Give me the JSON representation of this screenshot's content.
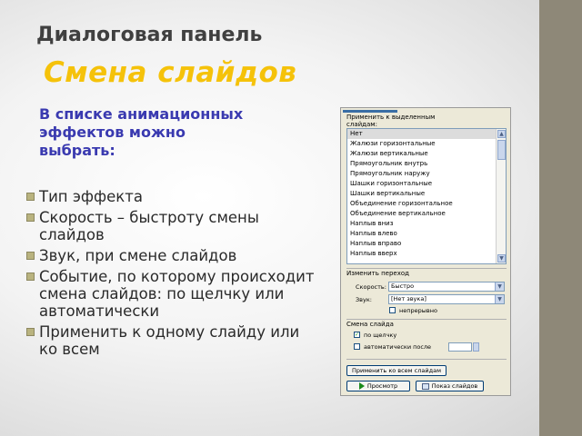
{
  "slide": {
    "title_line1": "Диалоговая панель",
    "title_line2": "Смена слайдов",
    "intro": "В списке анимационных эффектов можно выбрать:",
    "bullets": [
      "Тип эффекта",
      "Скорость – быстроту смены слайдов",
      "Звук, при смене слайдов",
      "Событие, по которому происходит смена слайдов: по щелчку или автоматически",
      "Применить к одному слайду или ко всем"
    ]
  },
  "dialog": {
    "apply_to_selected_label": "Применить к выделенным слайдам:",
    "effects": [
      "Нет",
      "Жалюзи горизонтальные",
      "Жалюзи вертикальные",
      "Прямоугольник внутрь",
      "Прямоугольник наружу",
      "Шашки горизонтальные",
      "Шашки вертикальные",
      "Объединение горизонтальное",
      "Объединение вертикальное",
      "Наплыв вниз",
      "Наплыв влево",
      "Наплыв вправо",
      "Наплыв вверх"
    ],
    "selected_effect": "Нет",
    "modify_transition_label": "Изменить переход",
    "speed_label": "Скорость:",
    "speed_value": "Быстро",
    "sound_label": "Звук:",
    "sound_value": "[Нет звука]",
    "loop_label": "непрерывно",
    "advance_label": "Смена слайда",
    "on_click_label": "по щелчку",
    "on_click_checked": true,
    "auto_label": "автоматически после",
    "auto_checked": false,
    "apply_all_label": "Применить ко всем слайдам",
    "play_label": "Просмотр",
    "slideshow_label": "Показ слайдов"
  },
  "colors": {
    "title_line2": "#f5c20a",
    "intro": "#3a3ab0",
    "side_strip": "#8e8878",
    "bullet_mark": "#b9b37f",
    "dialog_bg": "#ece9d8"
  }
}
